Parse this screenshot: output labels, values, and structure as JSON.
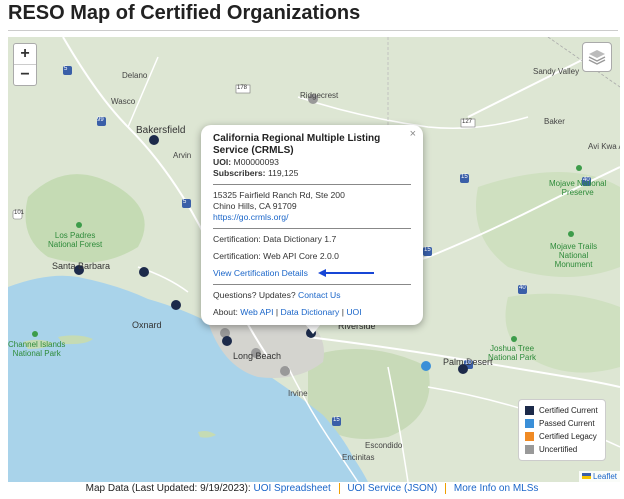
{
  "title": "RESO Map of Certified Organizations",
  "zoom": {
    "in_label": "+",
    "out_label": "−"
  },
  "map_labels": {
    "delano": "Delano",
    "wasco": "Wasco",
    "bakersfield": "Bakersfield",
    "arvin": "Arvin",
    "ridgecrest": "Ridgecrest",
    "sandy_valley": "Sandy Valley",
    "baker": "Baker",
    "avi_kwa_ame": "Avi Kwa Ame",
    "santa_barbara": "Santa Barbara",
    "oxnard": "Oxnard",
    "long_beach": "Long Beach",
    "irvine": "Irvine",
    "riverside": "Riverside",
    "palm_desert": "Palm Desert",
    "escondido": "Escondido",
    "encinitas": "Encinitas",
    "los_padres": "Los Padres\nNational Forest",
    "mojave_preserve": "Mojave National\nPreserve",
    "mojave_trails": "Mojave Trails\nNational\nMonument",
    "channel_islands": "Channel Islands\nNational Park",
    "joshua_tree": "Joshua Tree\nNational Park",
    "road_5": "5",
    "road_99": "99",
    "road_178": "178",
    "road_15": "15",
    "road_127": "127",
    "road_40": "40",
    "road_10": "10",
    "road_8": "8",
    "road_101": "101",
    "road_395": "395"
  },
  "popup": {
    "close": "×",
    "org_name": "California Regional Multiple Listing Service (CRMLS)",
    "uoi_label": "UOI:",
    "uoi_value": "M00000093",
    "subscribers_label": "Subscribers:",
    "subscribers_value": "119,125",
    "address_line1": "15325 Fairfield Ranch Rd, Ste 200",
    "address_line2": "Chino Hills, CA 91709",
    "website": "https://go.crmls.org/",
    "cert_dd": "Certification: Data Dictionary 1.7",
    "cert_webapi": "Certification: Web API Core 2.0.0",
    "view_cert": "View Certification Details",
    "questions": "Questions? Updates?",
    "contact": "Contact Us",
    "about_label": "About:",
    "about_links": [
      "Web API",
      "Data Dictionary",
      "UOI"
    ],
    "about_sep": "|"
  },
  "legend": {
    "items": [
      {
        "label": "Certified Current",
        "color": "#1c2a4a"
      },
      {
        "label": "Passed Current",
        "color": "#3a8fd8"
      },
      {
        "label": "Certified Legacy",
        "color": "#f08a24"
      },
      {
        "label": "Uncertified",
        "color": "#999999"
      }
    ]
  },
  "attribution": "Leaflet",
  "footer": {
    "prefix": "Map Data (Last Updated: 9/19/2023):",
    "links": [
      "UOI Spreadsheet",
      "UOI Service (JSON)",
      "More Info on MLSs"
    ]
  },
  "colors": {
    "certified_current": "#1c2a4a",
    "passed_current": "#3a8fd8",
    "uncertified": "#999999",
    "link": "#1b66c9",
    "arrow": "#1746d6"
  }
}
